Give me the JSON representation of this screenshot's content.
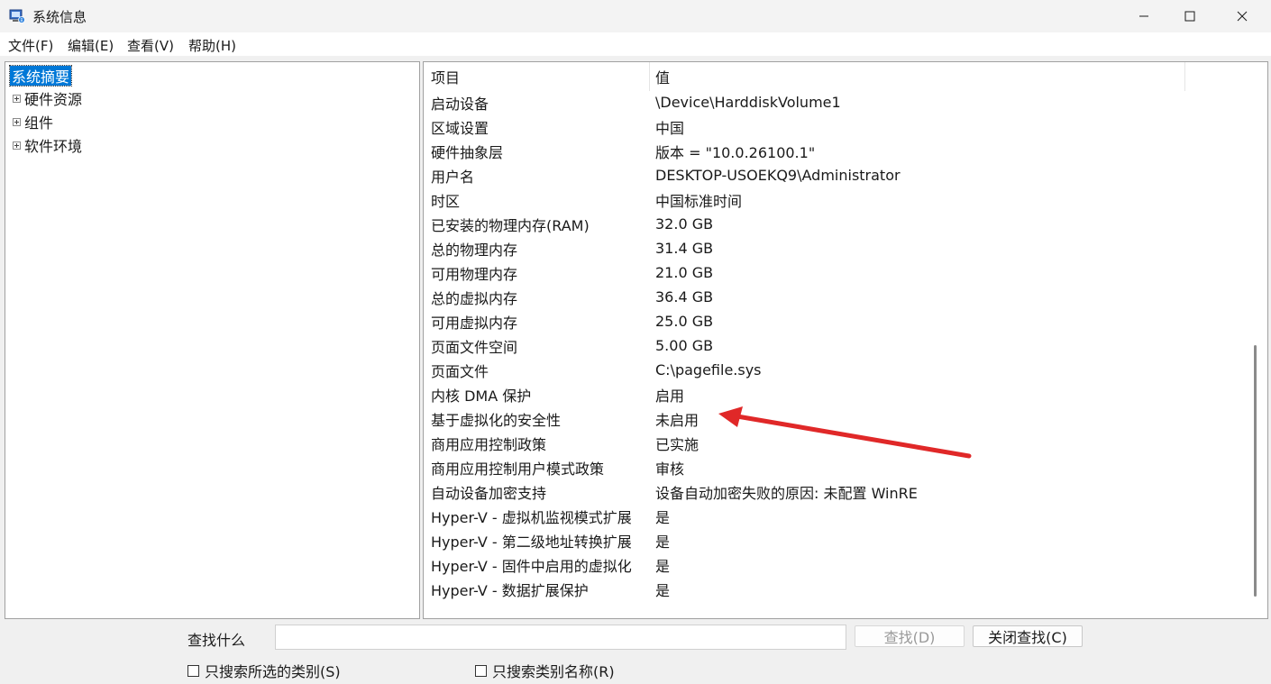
{
  "window": {
    "title": "系统信息"
  },
  "menu": [
    {
      "label": "文件(F)"
    },
    {
      "label": "编辑(E)"
    },
    {
      "label": "查看(V)"
    },
    {
      "label": "帮助(H)"
    }
  ],
  "tree": {
    "selected": "系统摘要",
    "items": [
      {
        "label": "硬件资源"
      },
      {
        "label": "组件"
      },
      {
        "label": "软件环境"
      }
    ]
  },
  "list": {
    "columns": {
      "item": "项目",
      "value": "值"
    },
    "rows": [
      {
        "item": "启动设备",
        "value": "\\Device\\HarddiskVolume1"
      },
      {
        "item": "区域设置",
        "value": "中国"
      },
      {
        "item": "硬件抽象层",
        "value": "版本 = \"10.0.26100.1\""
      },
      {
        "item": "用户名",
        "value": "DESKTOP-USOEKQ9\\Administrator"
      },
      {
        "item": "时区",
        "value": "中国标准时间"
      },
      {
        "item": "已安装的物理内存(RAM)",
        "value": "32.0 GB"
      },
      {
        "item": "总的物理内存",
        "value": "31.4 GB"
      },
      {
        "item": "可用物理内存",
        "value": "21.0 GB"
      },
      {
        "item": "总的虚拟内存",
        "value": "36.4 GB"
      },
      {
        "item": "可用虚拟内存",
        "value": "25.0 GB"
      },
      {
        "item": "页面文件空间",
        "value": "5.00 GB"
      },
      {
        "item": "页面文件",
        "value": "C:\\pagefile.sys"
      },
      {
        "item": "内核 DMA 保护",
        "value": "启用"
      },
      {
        "item": "基于虚拟化的安全性",
        "value": "未启用"
      },
      {
        "item": "商用应用控制政策",
        "value": "已实施"
      },
      {
        "item": "商用应用控制用户模式政策",
        "value": "审核"
      },
      {
        "item": "自动设备加密支持",
        "value": "设备自动加密失败的原因: 未配置 WinRE"
      },
      {
        "item": "Hyper-V - 虚拟机监视模式扩展",
        "value": "是"
      },
      {
        "item": "Hyper-V - 第二级地址转换扩展",
        "value": "是"
      },
      {
        "item": "Hyper-V - 固件中启用的虚拟化",
        "value": "是"
      },
      {
        "item": "Hyper-V - 数据扩展保护",
        "value": "是"
      }
    ]
  },
  "search": {
    "label": "查找什么",
    "value": "",
    "find_button": "查找(D)",
    "close_button": "关闭查找(C)",
    "option_selected_category": "只搜索所选的类别(S)",
    "option_category_names": "只搜索类别名称(R)"
  },
  "annotation": {
    "color": "#e02828"
  }
}
